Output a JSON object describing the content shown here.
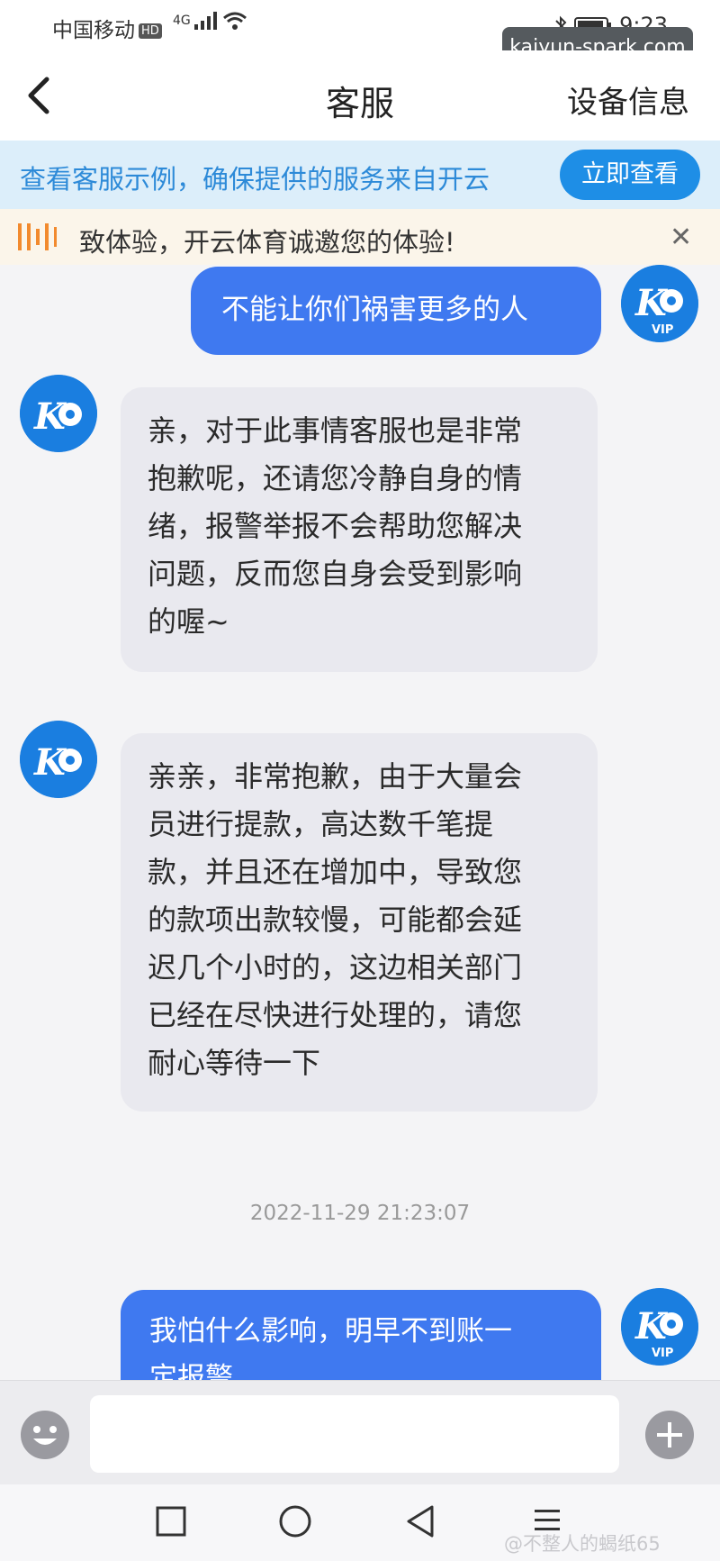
{
  "status_bar": {
    "carrier": "中国移动",
    "hd": "HD",
    "network": "4G",
    "time": "9:23"
  },
  "watermark_top": "kaiyun-spark.com",
  "nav": {
    "title": "客服",
    "device_info": "设备信息"
  },
  "promo": {
    "text": "查看客服示例，确保提供的服务来自开云",
    "button": "立即查看"
  },
  "notice": {
    "text": "致体验，开云体育诚邀您的体验!"
  },
  "chat": {
    "messages": [
      {
        "from": "user",
        "text": "不能让你们祸害更多的人"
      },
      {
        "from": "agent",
        "lines": [
          "亲，对于此事情客服也是非常",
          "抱歉呢，还请您冷静自身的情",
          "绪，报警举报不会帮助您解决",
          "问题，反而您自身会受到影响",
          "的喔~"
        ]
      },
      {
        "from": "agent",
        "lines": [
          "亲亲，非常抱歉，由于大量会",
          "员进行提款，高达数千笔提",
          "款，并且还在增加中，导致您",
          "的款项出款较慢，可能都会延",
          "迟几个小时的，这边相关部门",
          "已经在尽快进行处理的，请您",
          "耐心等待一下"
        ]
      },
      {
        "from": "user",
        "lines": [
          "我怕什么影响，明早不到账一",
          "定报警"
        ]
      }
    ],
    "timestamp": "2022-11-29 21:23:07",
    "avatar_badge": "VIP"
  },
  "input": {
    "placeholder": ""
  },
  "credit": "@不整人的蝎纸65",
  "colors": {
    "sent_bubble": "#3f79f0",
    "received_bubble": "#e9e9ef",
    "accent": "#1e8ee6",
    "promo_bg": "#dceefa"
  }
}
